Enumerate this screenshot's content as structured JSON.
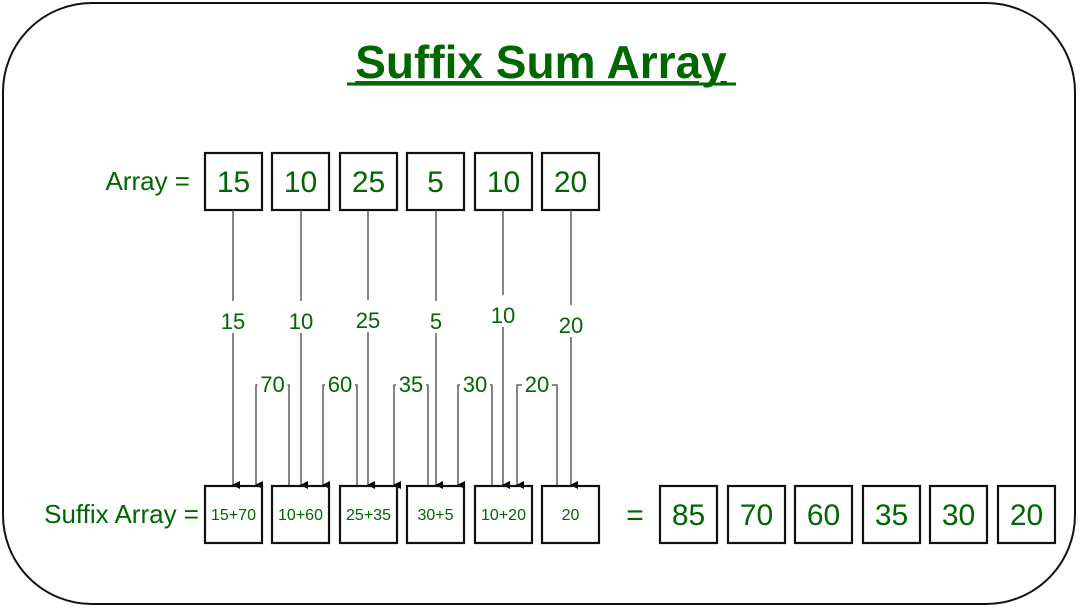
{
  "title": "Suffix Sum Array",
  "array_label": "Array =",
  "suffix_label": "Suffix Array =",
  "equals": "=",
  "array": [
    "15",
    "10",
    "25",
    "5",
    "10",
    "20"
  ],
  "down_labels": [
    "15",
    "10",
    "25",
    "5",
    "10",
    "20"
  ],
  "carry_labels": [
    "70",
    "60",
    "35",
    "30",
    "20"
  ],
  "suffix_expr": [
    "15+70",
    "10+60",
    "25+35",
    "30+5",
    "10+20",
    "20"
  ],
  "result": [
    "85",
    "70",
    "60",
    "35",
    "30",
    "20"
  ],
  "colors": {
    "text": "#006600",
    "border": "#111111",
    "line": "#555555"
  }
}
